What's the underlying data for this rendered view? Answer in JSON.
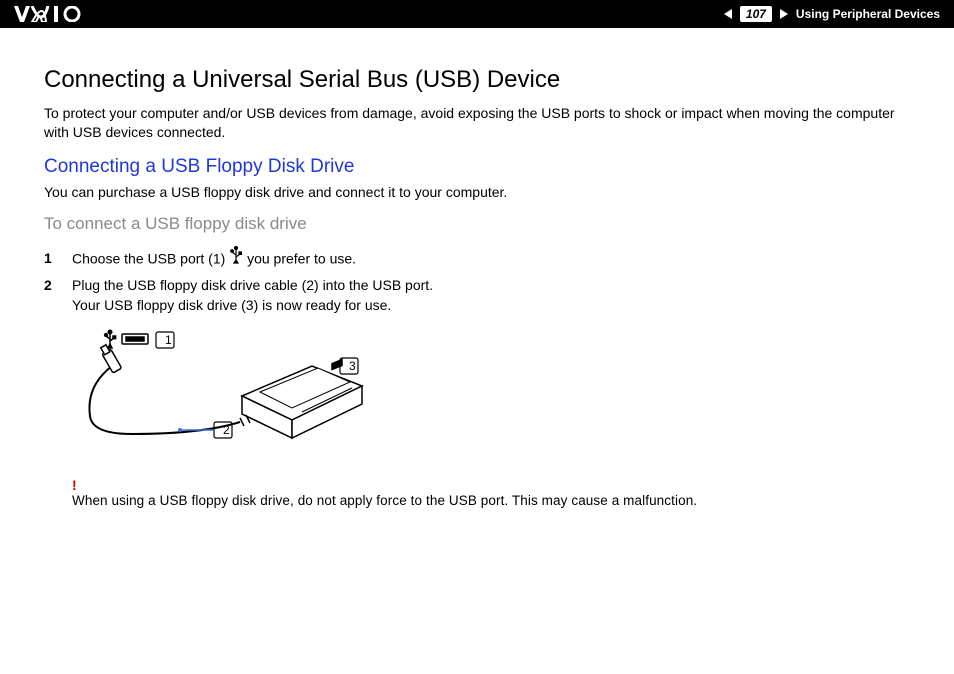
{
  "header": {
    "page_number": "107",
    "section_label": "Using Peripheral Devices"
  },
  "title": "Connecting a Universal Serial Bus (USB) Device",
  "intro": "To protect your computer and/or USB devices from damage, avoid exposing the USB ports to shock or impact when moving the computer with USB devices connected.",
  "subtitle_blue": "Connecting a USB Floppy Disk Drive",
  "subtitle_blue_body": "You can purchase a USB floppy disk drive and connect it to your computer.",
  "subtitle_grey": "To connect a USB floppy disk drive",
  "steps": [
    {
      "num": "1",
      "text_before_icon": "Choose the USB port (1) ",
      "text_after_icon": " you prefer to use."
    },
    {
      "num": "2",
      "line1": "Plug the USB floppy disk drive cable (2) into the USB port.",
      "line2": "Your USB floppy disk drive (3) is now ready for use."
    }
  ],
  "diagram": {
    "callout1": "1",
    "callout2": "2",
    "callout3": "3"
  },
  "warning": {
    "bang": "!",
    "text": "When using a USB floppy disk drive, do not apply force to the USB port. This may cause a malfunction."
  }
}
